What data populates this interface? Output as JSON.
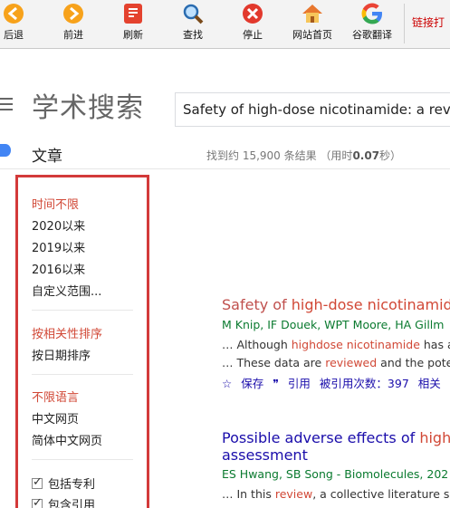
{
  "toolbar": {
    "back": "后退",
    "forward": "前进",
    "refresh": "刷新",
    "find": "查找",
    "stop": "停止",
    "home": "网站首页",
    "translate": "谷歌翻译",
    "link": "链接打"
  },
  "header": {
    "logo": "学术搜索",
    "search_value": "Safety of high-dose nicotinamide: a review"
  },
  "section": {
    "title": "文章",
    "stats_prefix": "找到约 15,900 条结果 （用时",
    "stats_time": "0.07",
    "stats_suffix": "秒）"
  },
  "filters": {
    "time": [
      "时间不限",
      "2020以来",
      "2019以来",
      "2016以来",
      "自定义范围..."
    ],
    "sort": [
      "按相关性排序",
      "按日期排序"
    ],
    "lang": [
      "不限语言",
      "中文网页",
      "简体中文网页"
    ],
    "checks": [
      "包括专利",
      "包含引用"
    ]
  },
  "results": [
    {
      "title_a": "Safety of ",
      "title_hl": "high-dose nicotinamide",
      "title_b": ":",
      "authors": "M Knip, IF Douek, WPT Moore, HA Gillm",
      "snip1_a": "… Although ",
      "snip1_hl": "highdose nicotinamide",
      "snip1_b": " has a",
      "snip2_a": "… These data are ",
      "snip2_hl": "reviewed",
      "snip2_b": " and the pote",
      "save": "保存",
      "cite": "引用",
      "cited_by": "被引用次数：397",
      "related": "相关"
    },
    {
      "title_a": "Possible adverse effects of ",
      "title_hl": "high-d",
      "title_line2": "assessment",
      "authors": "ES Hwang, SB Song - Biomolecules, 202",
      "snip1_a": "… In this ",
      "snip1_hl": "review",
      "snip1_b": ", a collective literature se"
    }
  ],
  "colors": {
    "accent_red": "#d14836",
    "link_blue": "#1a0dab",
    "author_green": "#0a7a2f",
    "highlight_box": "#d33a3a"
  }
}
